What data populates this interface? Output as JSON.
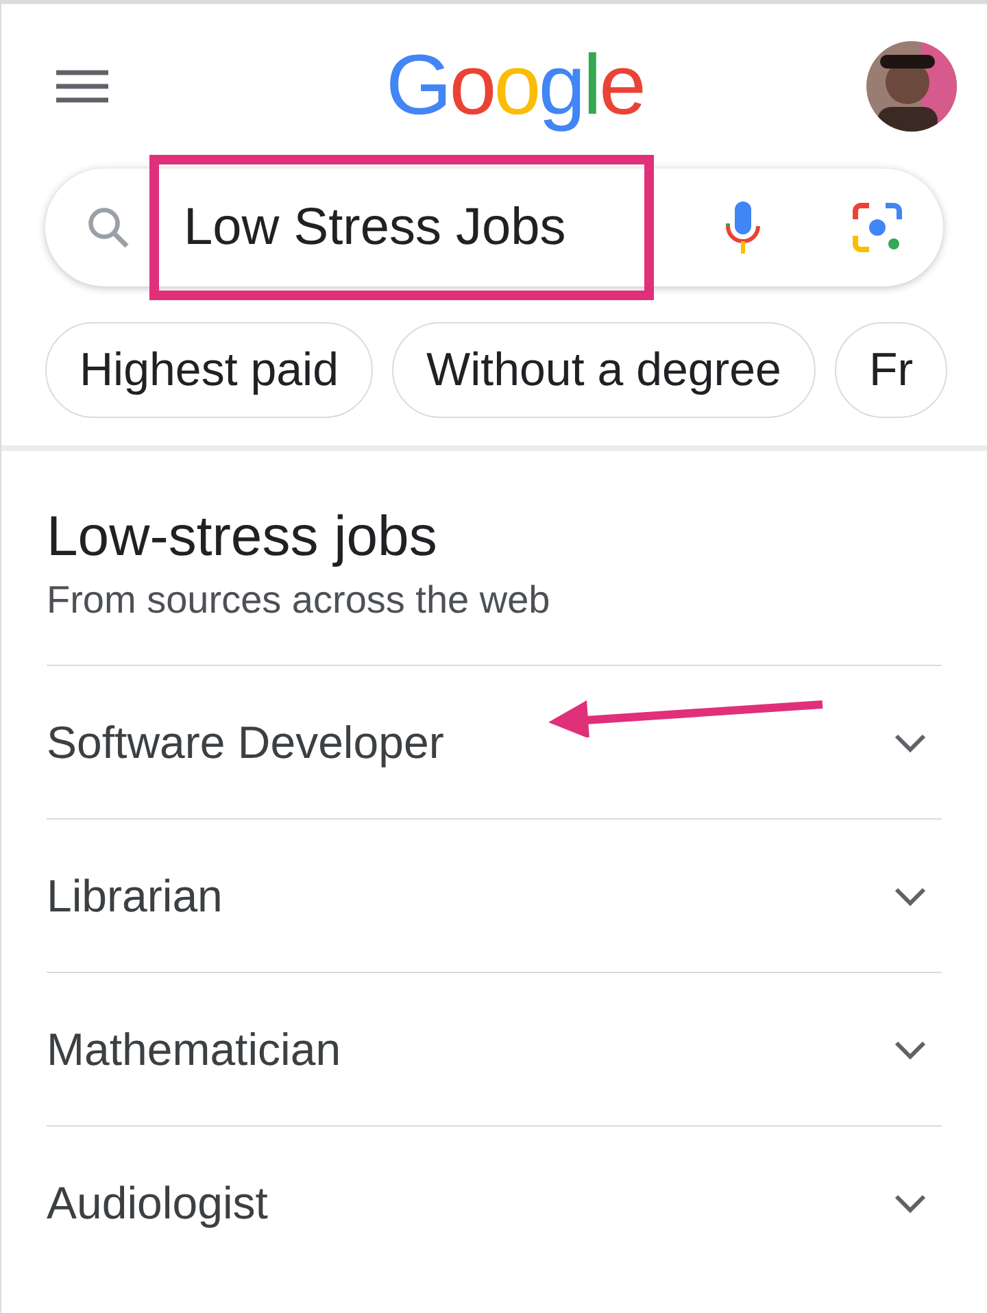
{
  "header": {
    "logo": "Google"
  },
  "search": {
    "value": "Low Stress Jobs",
    "highlighted": true
  },
  "chips": [
    {
      "label": "Highest paid"
    },
    {
      "label": "Without a degree"
    },
    {
      "label": "Fr"
    }
  ],
  "section": {
    "title": "Low-stress jobs",
    "subtitle": "From sources across the web"
  },
  "items": [
    {
      "label": "Software Developer",
      "expanded": false,
      "annotated": true
    },
    {
      "label": "Librarian",
      "expanded": false,
      "annotated": false
    },
    {
      "label": "Mathematician",
      "expanded": false,
      "annotated": false
    },
    {
      "label": "Audiologist",
      "expanded": false,
      "annotated": false
    }
  ]
}
